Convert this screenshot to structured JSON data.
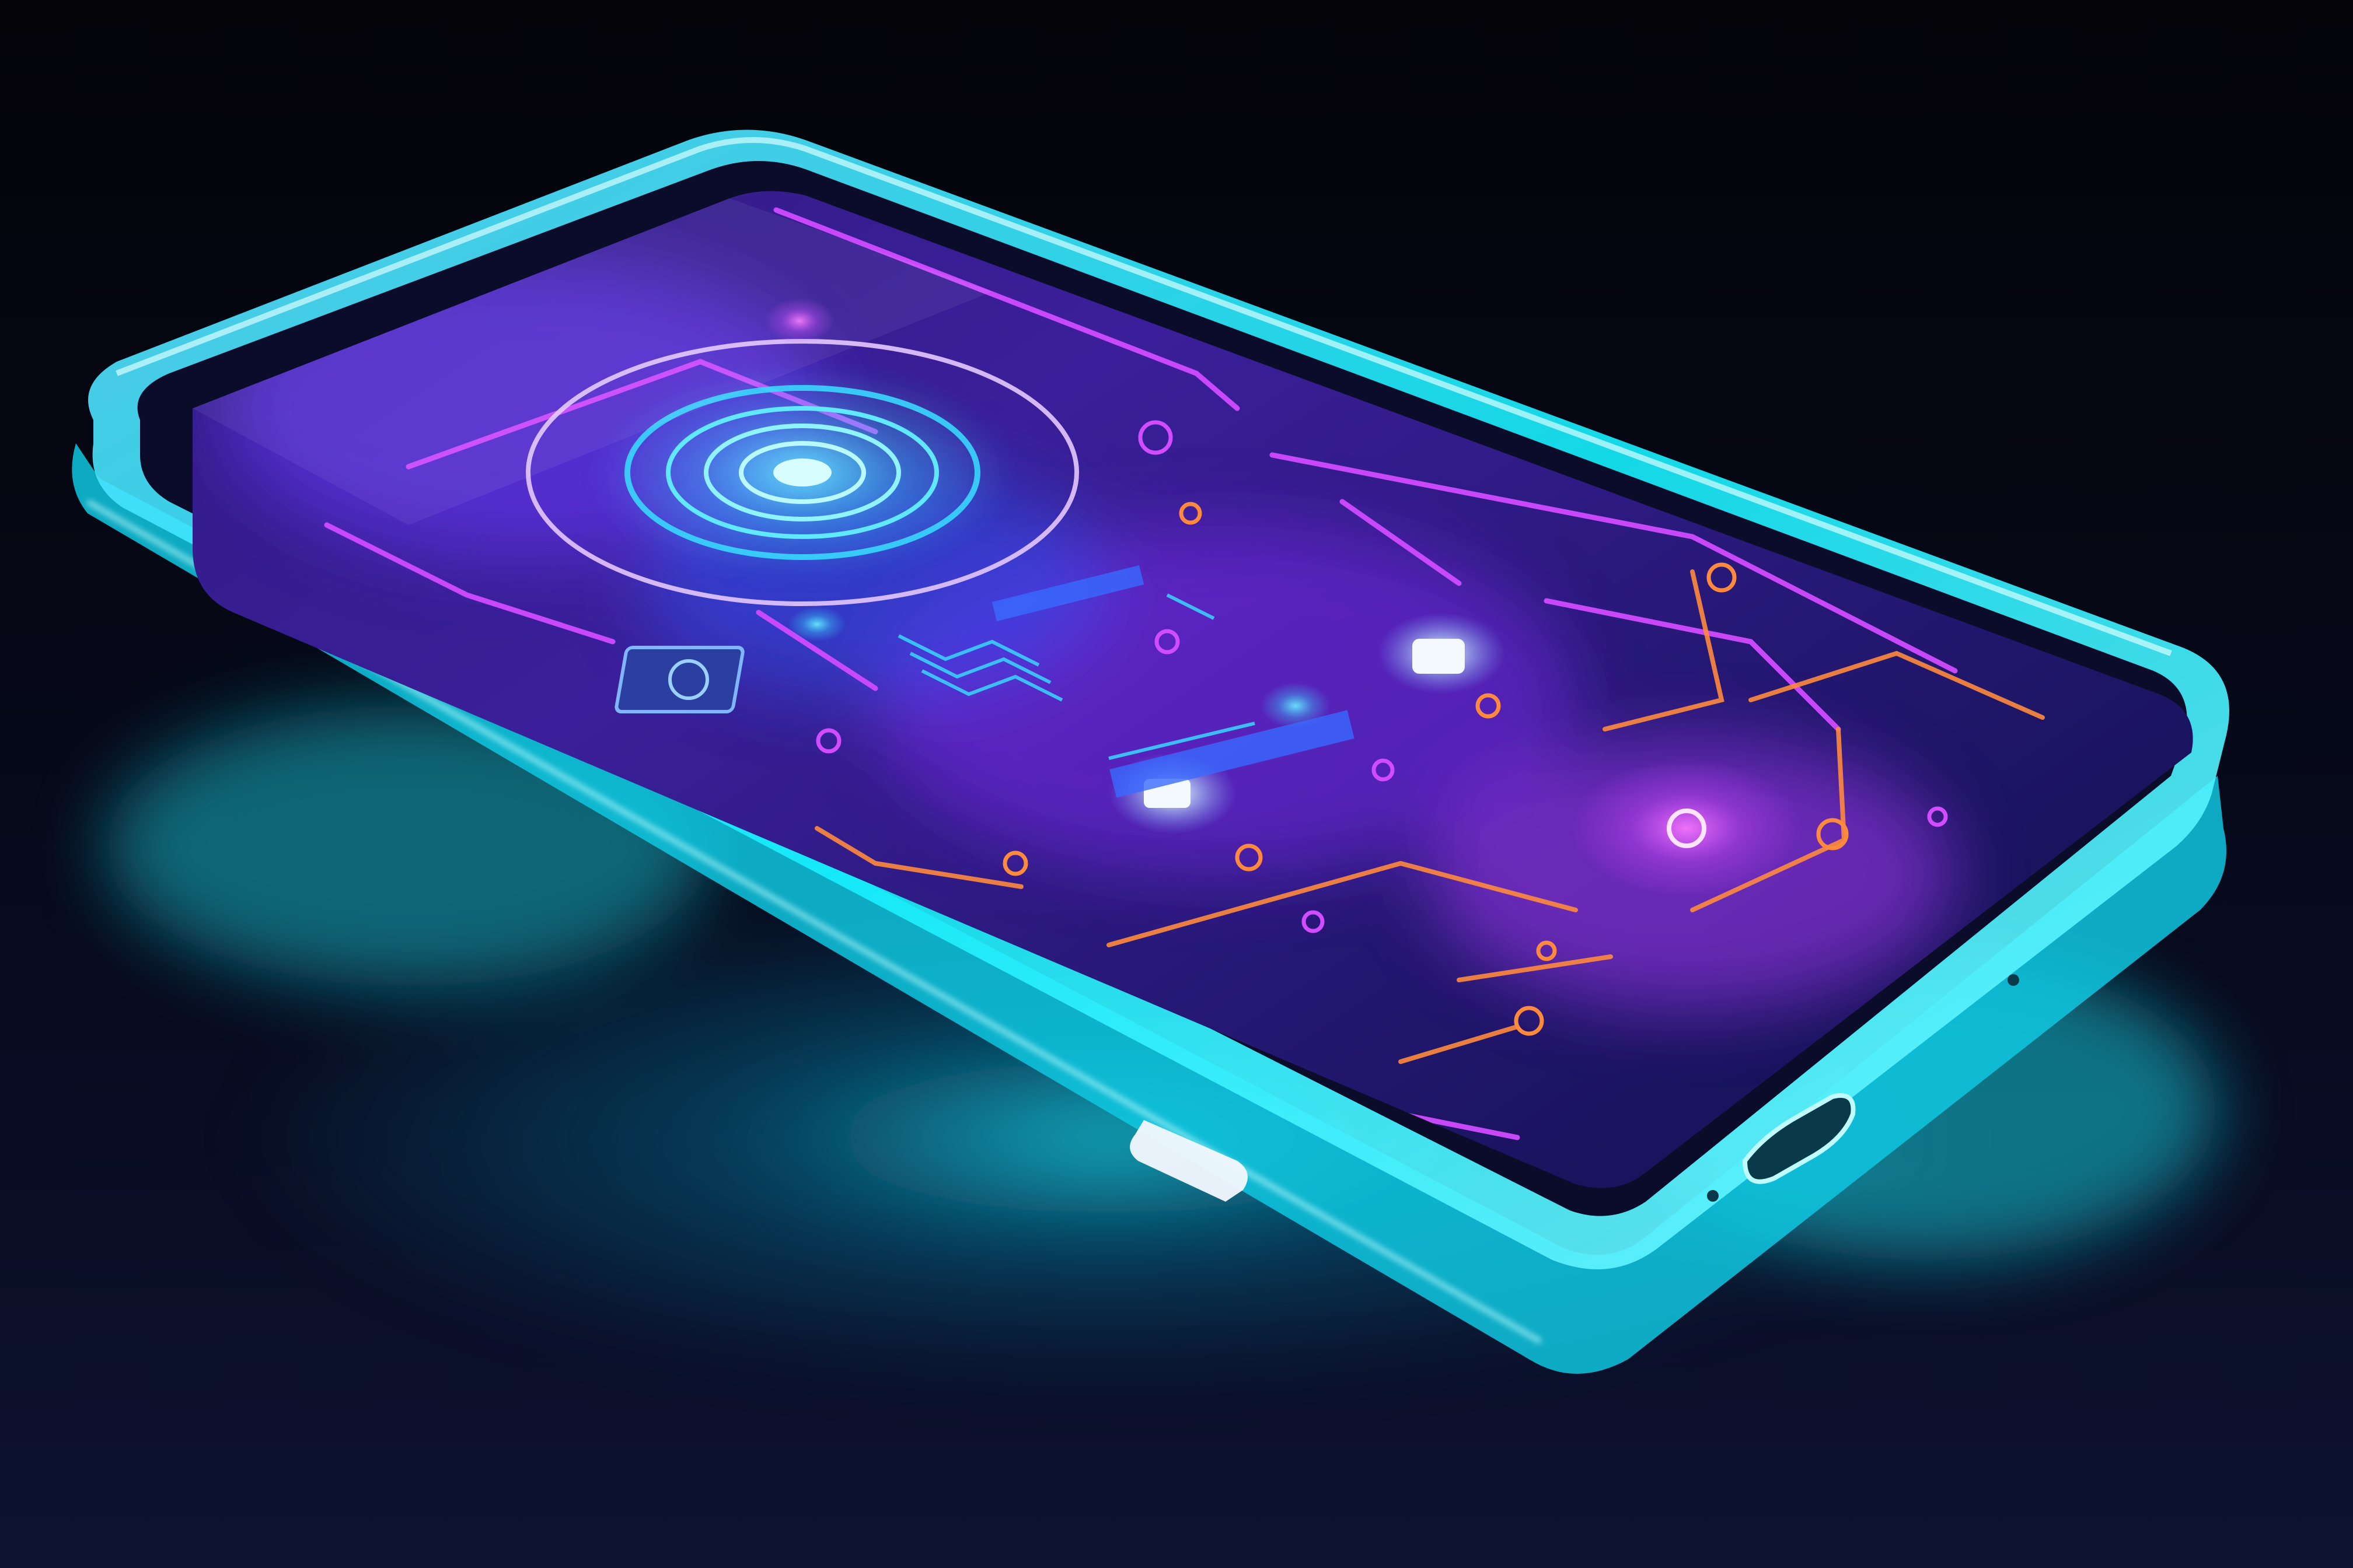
{
  "scene": {
    "subject": "smartphone",
    "colors": {
      "background_top": "#030308",
      "background_bottom": "#0d1230",
      "glow_cyan": "#16f0ff",
      "glow_cyan_soft": "#0a8fb8",
      "frame_edge": "#7ff6ff",
      "screen_deep": "#0b0c3a",
      "screen_mid": "#2a1a7a",
      "circuit_magenta": "#d14bff",
      "circuit_orange": "#ff8a3d",
      "circuit_cyan": "#3ad8ff",
      "highlight_white": "#f4f8ff"
    },
    "icons": {
      "fingerprint": "fingerprint-icon",
      "chip": "chip-icon",
      "nodes": "circuit-node-icon",
      "port": "charging-port-icon",
      "button": "side-button-icon"
    }
  }
}
